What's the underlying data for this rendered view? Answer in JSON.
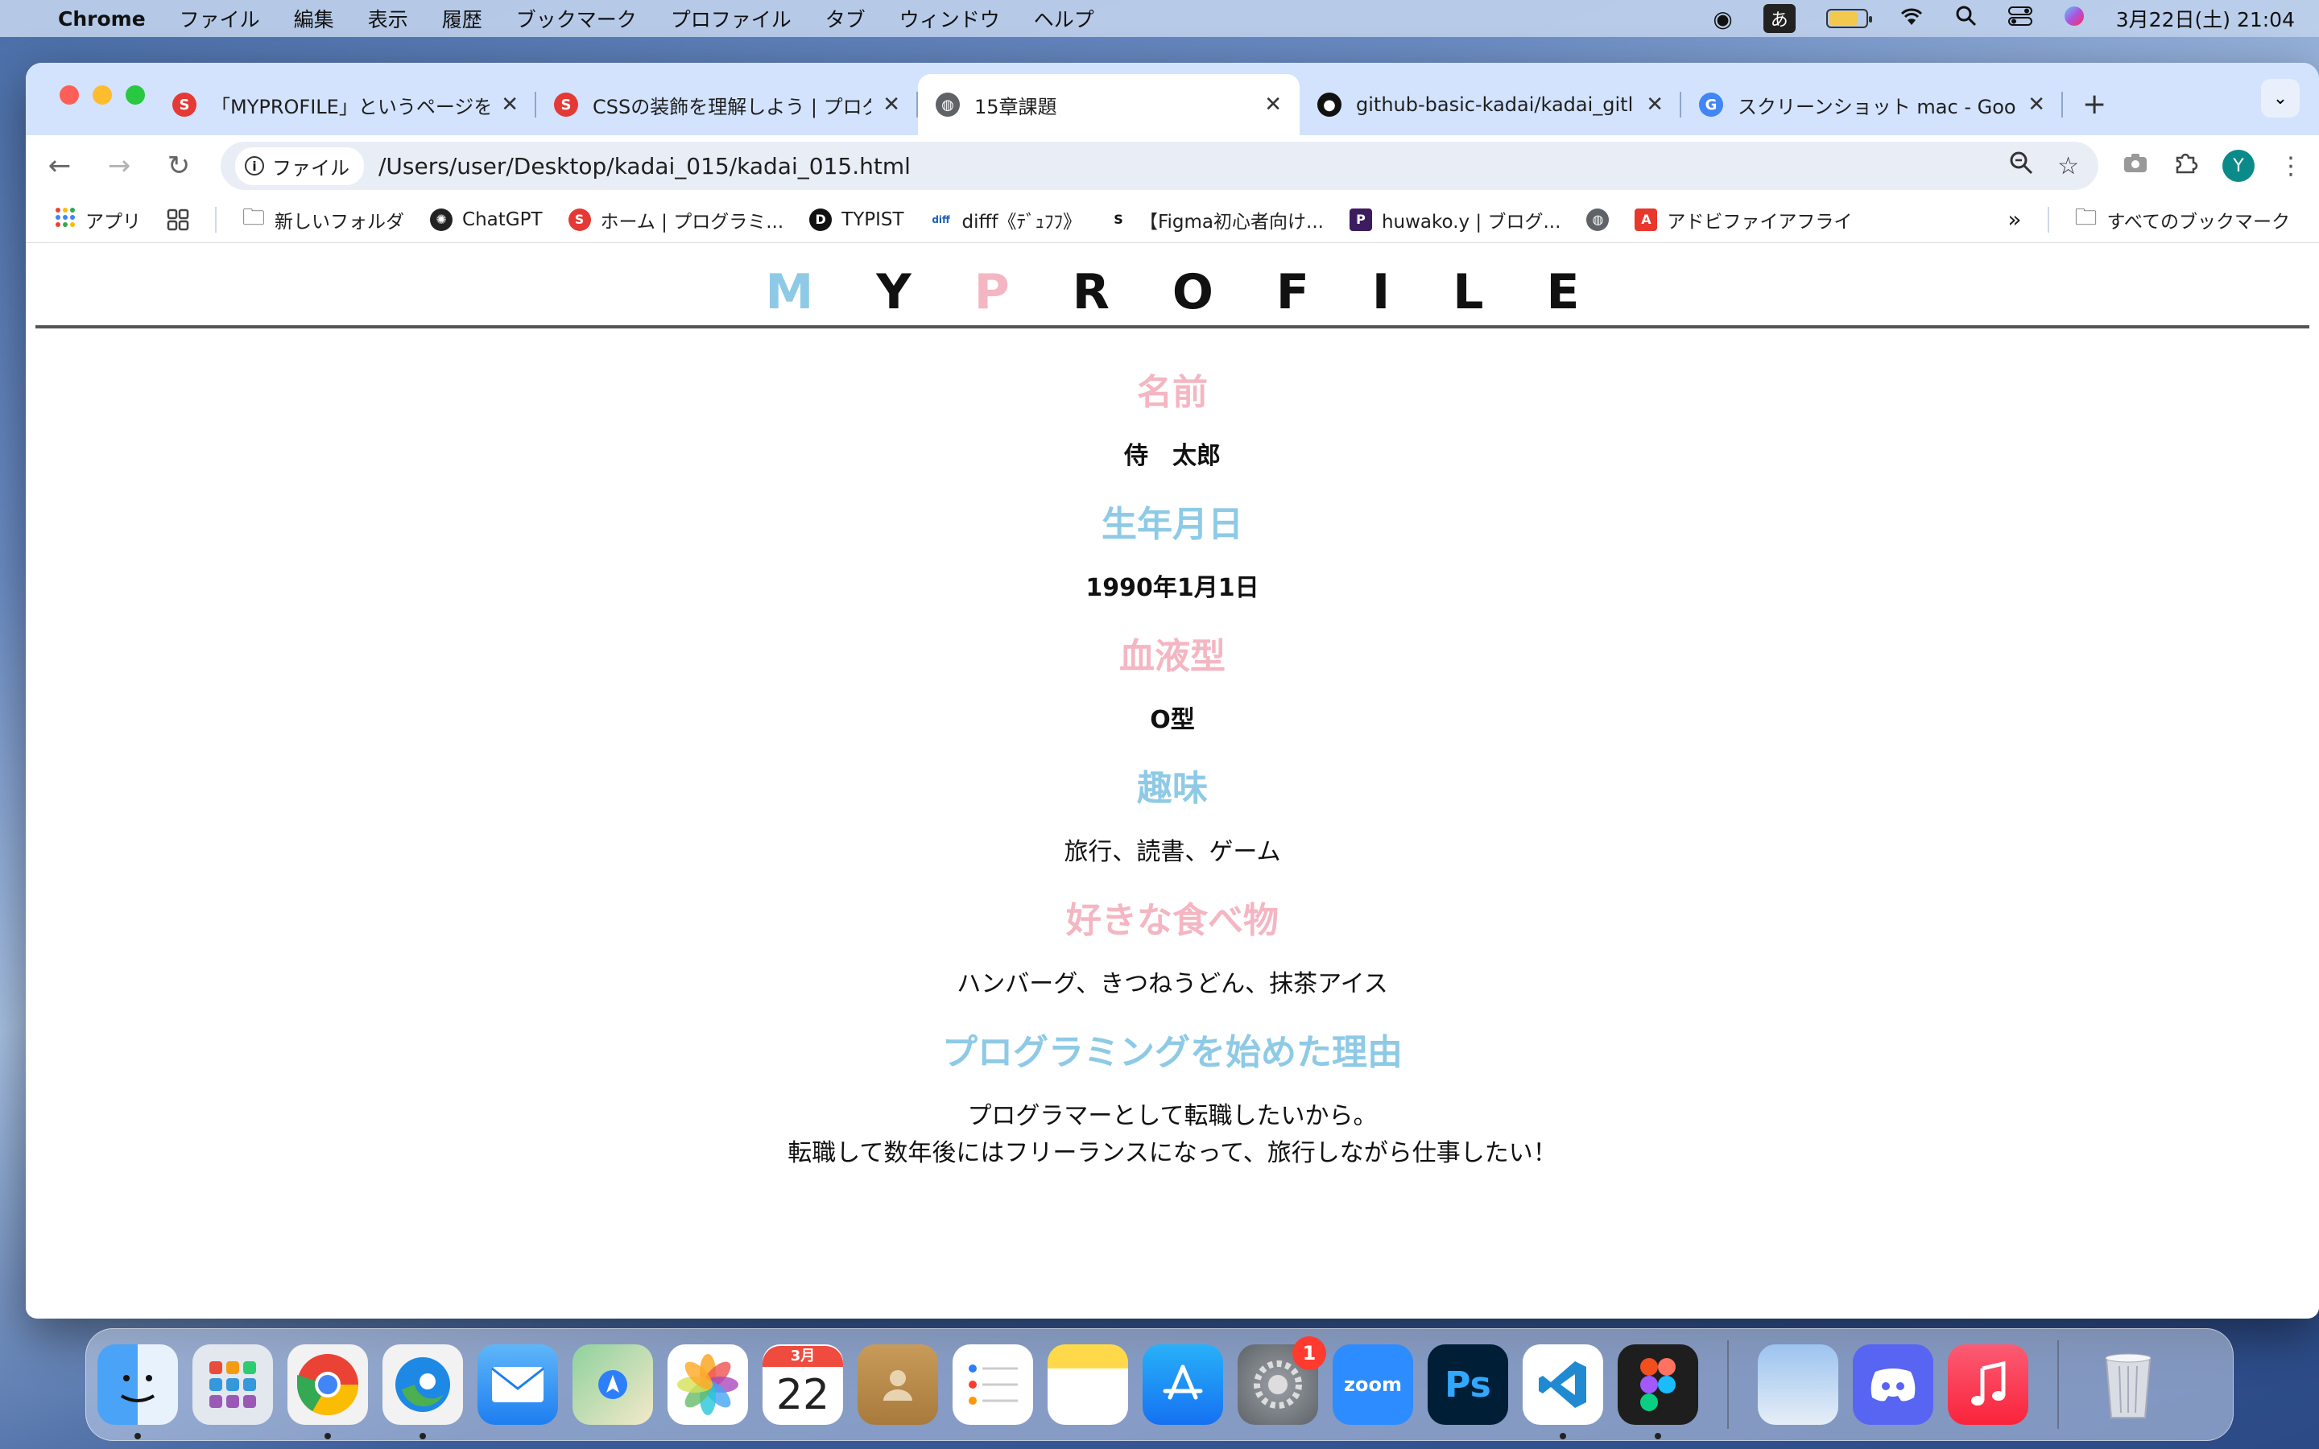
{
  "menubar": {
    "app_name": "Chrome",
    "items": [
      "ファイル",
      "編集",
      "表示",
      "履歴",
      "ブックマーク",
      "プロファイル",
      "タブ",
      "ウィンドウ",
      "ヘルプ"
    ],
    "ime": "あ",
    "clock": "3月22日(土) 21:04"
  },
  "tabs": [
    {
      "title": "「MYPROFILE」というページを",
      "favicon_color": "#e53935",
      "active": false
    },
    {
      "title": "CSSの装飾を理解しよう | プログ",
      "favicon_color": "#e53935",
      "active": false
    },
    {
      "title": "15章課題",
      "favicon_color": "#5f6368",
      "active": true
    },
    {
      "title": "github-basic-kadai/kadai_gitl",
      "favicon_color": "#111111",
      "active": false
    },
    {
      "title": "スクリーンショット mac - Goog",
      "favicon_color": "#4285f4",
      "active": false
    }
  ],
  "omnibox": {
    "chip_label": "ファイル",
    "url": "/Users/user/Desktop/kadai_015/kadai_015.html"
  },
  "profile_initial": "Y",
  "bookmarks": {
    "apps_label": "アプリ",
    "items": [
      {
        "label": "新しいフォルダ",
        "icon": "folder-icon"
      },
      {
        "label": "ChatGPT",
        "icon": "chatgpt-icon"
      },
      {
        "label": "ホーム | プログラミ...",
        "icon": "samurai-icon"
      },
      {
        "label": "TYPIST",
        "icon": "typist-icon"
      },
      {
        "label": "difff《ﾃﾞｭﾌﾌ》",
        "icon": "difff-icon"
      },
      {
        "label": "【Figma初心者向け...",
        "icon": "figma-guide-icon"
      },
      {
        "label": "huwako.y | ブログ...",
        "icon": "blog-icon"
      },
      {
        "label": "",
        "icon": "globe-icon"
      },
      {
        "label": "アドビファイアフライ",
        "icon": "adobe-icon"
      }
    ],
    "all_bookmarks": "すべてのブックマーク"
  },
  "page": {
    "logo_letters": [
      "M",
      "Y",
      "P",
      "R",
      "O",
      "F",
      "I",
      "L",
      "E"
    ],
    "sections": [
      {
        "heading": "名前",
        "value": "侍　太郎",
        "bold": true,
        "color": "pink"
      },
      {
        "heading": "生年月日",
        "value": "1990年1月1日",
        "bold": true,
        "color": "blue"
      },
      {
        "heading": "血液型",
        "value": "O型",
        "bold": true,
        "color": "pink"
      },
      {
        "heading": "趣味",
        "value": "旅行、読書、ゲーム",
        "bold": false,
        "color": "blue"
      },
      {
        "heading": "好きな食べ物",
        "value": "ハンバーグ、きつねうどん、抹茶アイス",
        "bold": false,
        "color": "pink"
      },
      {
        "heading": "プログラミングを始めた理由",
        "value": "プログラマーとして転職したいから。",
        "value2": "転職して数年後にはフリーランスになって、旅行しながら仕事したい！",
        "bold": false,
        "color": "blue"
      }
    ]
  },
  "colors": {
    "accent_pink": "#f4b6c2",
    "accent_blue": "#8ecae6"
  },
  "dock": {
    "apps": [
      "finder",
      "launchpad",
      "chrome",
      "edge",
      "mail",
      "maps",
      "photos",
      "calendar",
      "contacts",
      "reminders",
      "notes",
      "app-store",
      "system-settings",
      "zoom",
      "photoshop",
      "vscode",
      "figma",
      "preview",
      "discord",
      "music",
      "trash"
    ],
    "calendar_month": "3月",
    "calendar_day": "22",
    "settings_badge": "1",
    "zoom_label": "zoom",
    "photoshop_label": "Ps"
  }
}
